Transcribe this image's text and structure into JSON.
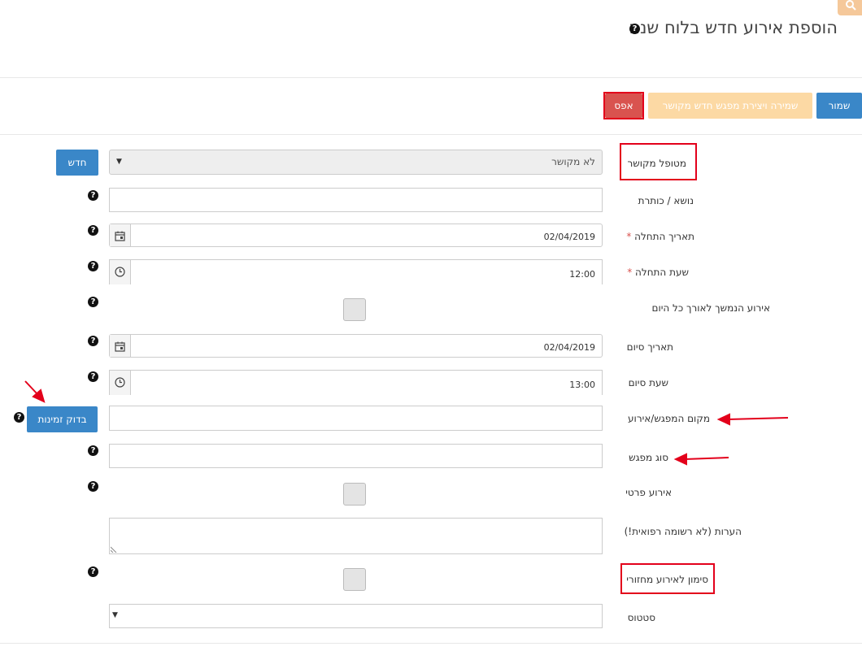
{
  "page": {
    "title": "הוספת אירוע חדש בלוח שנה"
  },
  "toolbar": {
    "save_label": "שמור",
    "save_new_label": "שמירה ויצירת מפגש חדש מקושר",
    "reset_label": "אפס"
  },
  "form": {
    "linked_client": {
      "label": "מטופל מקושר",
      "value": "לא מקושר",
      "new_label": "חדש"
    },
    "subject": {
      "label": "נושא / כותרת",
      "value": ""
    },
    "start_date": {
      "label": "תאריך התחלה",
      "required": "*",
      "value": "02/04/2019"
    },
    "start_time": {
      "label": "שעת התחלה",
      "required": "*",
      "value": "12:00"
    },
    "all_day": {
      "label": "אירוע הנמשך לאורך כל היום"
    },
    "end_date": {
      "label": "תאריך סיום",
      "value": "02/04/2019"
    },
    "end_time": {
      "label": "שעת סיום",
      "value": "13:00"
    },
    "location": {
      "label": "מקום המפגש/אירוע",
      "value": "",
      "check_label": "בדוק זמינות"
    },
    "meeting_type": {
      "label": "סוג מפגש",
      "value": ""
    },
    "private_event": {
      "label": "אירוע פרטי"
    },
    "notes": {
      "label": "הערות (לא רשומה רפואית!)",
      "value": ""
    },
    "recurring": {
      "label": "סימון לאירוע מחזורי"
    },
    "status": {
      "label": "סטטוס",
      "value": ""
    }
  },
  "icons": {
    "help": "?",
    "caret": "▼"
  },
  "colors": {
    "primary": "#3a87c8",
    "danger": "#d9534f",
    "warning_light": "#fcd9a4",
    "annotation_red": "#e3001b"
  }
}
